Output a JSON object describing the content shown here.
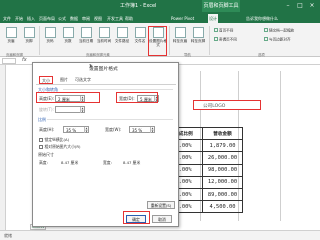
{
  "window": {
    "title": "工作簿1 - Excel",
    "context_tab": "页眉和页脚工具"
  },
  "ribbon_tabs": [
    "文件",
    "开始",
    "插入",
    "页面布局",
    "公式",
    "数据",
    "审阅",
    "视图",
    "开发工具",
    "帮助",
    "Power Pivot",
    "设计"
  ],
  "tell_me": "告诉我你想做什么",
  "ribbon": {
    "buttons": [
      {
        "label": "页眉"
      },
      {
        "label": "页脚"
      },
      {
        "label": "页码"
      },
      {
        "label": "页数"
      },
      {
        "label": "当前日期"
      },
      {
        "label": "当前时间"
      },
      {
        "label": "文件路径"
      },
      {
        "label": "文件名"
      },
      {
        "label": "工作表名"
      },
      {
        "label": "图片"
      },
      {
        "label": "设置图片格式"
      },
      {
        "label": "转至页眉"
      },
      {
        "label": "转至页脚"
      }
    ],
    "options": [
      "首页不同",
      "奇偶页不同",
      "随文档一起缩放",
      "与页边距对齐"
    ],
    "groups": [
      "页眉和页脚",
      "页眉和页脚元素",
      "导航",
      "选项"
    ]
  },
  "sheet": {
    "header_placeholder": "公司LOGO",
    "table": {
      "headers": [
        "完成比例",
        "营收金额"
      ],
      "rows": [
        [
          "0.00%",
          "1,879.00"
        ],
        [
          "0.00%",
          "26,000.00"
        ],
        [
          "0.00%",
          "98,000.00"
        ],
        [
          "0.00%",
          "12,000.00"
        ],
        [
          "0.00%",
          "89,000.00"
        ],
        [
          "0.00%",
          "4,500.00"
        ]
      ]
    },
    "sheet_tab": "Sheet1",
    "status": "就绪"
  },
  "dialog": {
    "title": "设置图片格式",
    "help_icon": "?",
    "close_icon": "×",
    "tabs": [
      "大小",
      "图片",
      "可选文字"
    ],
    "size_section": "大小和转角",
    "height_label": "高度(E):",
    "height_value": "2 厘米",
    "width_label": "宽度(D):",
    "width_value": "5 厘米",
    "rotation_label": "旋转(T):",
    "rotation_value": "",
    "scale_section": "比例",
    "scale_height_label": "高度(H):",
    "scale_height_value": "35 %",
    "scale_width_label": "宽度(W):",
    "scale_width_value": "35 %",
    "lock_aspect": "锁定纵横比(A)",
    "relative_original": "相对原始图片大小(R)",
    "original_section": "原始尺寸",
    "original_height_label": "高度:",
    "original_height_value": "8.47 厘米",
    "original_width_label": "宽度:",
    "original_width_value": "8.47 厘米",
    "reset_button": "重新设置(S)",
    "ok_button": "确定",
    "cancel_button": "取消"
  },
  "colors": {
    "excel_green": "#217346",
    "highlight_red": "#e53333"
  }
}
